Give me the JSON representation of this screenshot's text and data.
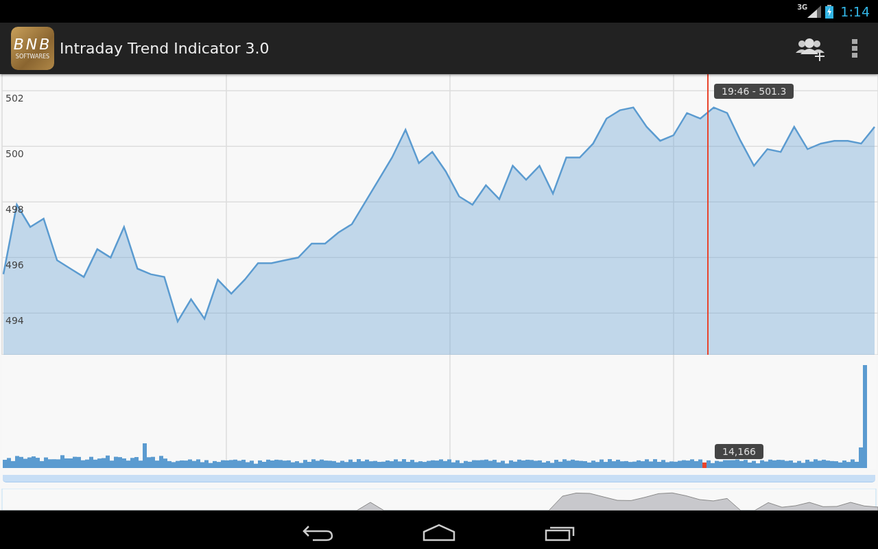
{
  "status_bar": {
    "network": "3G",
    "time": "1:14"
  },
  "app_bar": {
    "logo": {
      "text": "BNB",
      "subtitle": "SOFTWARES"
    },
    "title": "Intraday Trend Indicator 3.0"
  },
  "price_chart": {
    "tooltip": "19:46 - 501.3",
    "chart_data": {
      "type": "area",
      "ylim": [
        492.5,
        502.6
      ],
      "yticks": [
        494,
        496,
        498,
        500,
        502
      ],
      "grid": true,
      "series": [
        {
          "color": "#5b9bd0",
          "values": [
            495.4,
            497.9,
            497.1,
            497.4,
            495.9,
            495.6,
            495.3,
            496.3,
            496.0,
            497.1,
            495.6,
            495.4,
            495.3,
            493.7,
            494.5,
            493.8,
            495.2,
            494.7,
            495.2,
            495.8,
            495.8,
            495.9,
            496.0,
            496.5,
            496.5,
            496.9,
            497.2,
            498.0,
            498.8,
            499.6,
            500.6,
            499.4,
            499.8,
            499.1,
            498.2,
            497.9,
            498.6,
            498.1,
            499.3,
            498.8,
            499.3,
            498.3,
            499.6,
            499.6,
            500.1,
            501.0,
            501.3,
            501.4,
            500.7,
            500.2,
            500.4,
            501.2,
            501.0,
            501.4,
            501.2,
            500.2,
            499.3,
            499.9,
            499.8,
            500.7,
            499.9,
            500.1,
            500.2,
            500.2,
            500.1,
            500.7
          ]
        }
      ]
    }
  },
  "volume_chart": {
    "tooltip": "14,166"
  }
}
